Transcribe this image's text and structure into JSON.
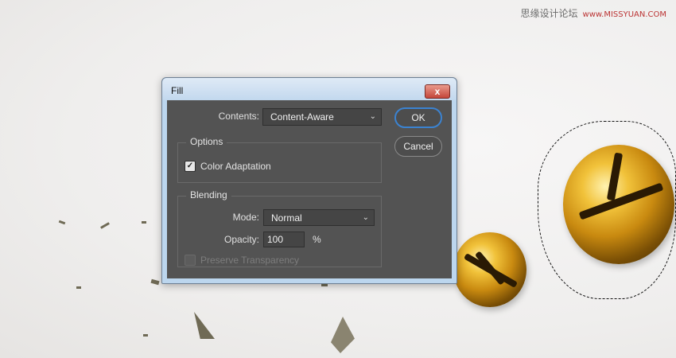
{
  "watermark": {
    "text": "思缘设计论坛",
    "url": "www.MISSYUAN.COM"
  },
  "dialog": {
    "title": "Fill",
    "close_glyph": "x",
    "contents_label": "Contents:",
    "contents_value": "Content-Aware",
    "ok_label": "OK",
    "cancel_label": "Cancel",
    "options_title": "Options",
    "color_adaptation_label": "Color Adaptation",
    "color_adaptation_checked": true,
    "blending_title": "Blending",
    "mode_label": "Mode:",
    "mode_value": "Normal",
    "opacity_label": "Opacity:",
    "opacity_value": "100",
    "opacity_unit": "%",
    "preserve_label": "Preserve Transparency",
    "preserve_checked": false,
    "preserve_enabled": false,
    "check_glyph": "✓",
    "chevron_glyph": "⌄"
  }
}
